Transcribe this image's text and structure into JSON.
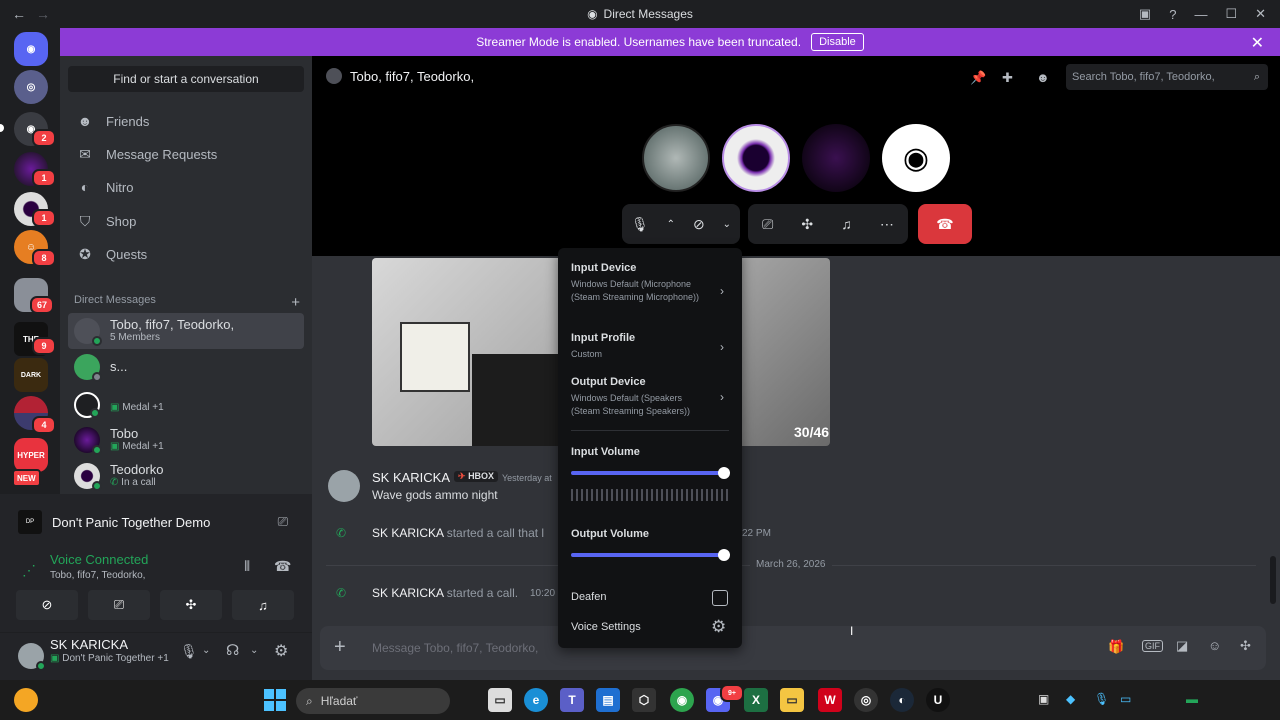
{
  "window": {
    "title": "Direct Messages"
  },
  "banner": {
    "text": "Streamer Mode is enabled. Usernames have been truncated.",
    "button": "Disable"
  },
  "dm_sidebar": {
    "search_label": "Find or start a conversation",
    "nav": [
      "Friends",
      "Message Requests",
      "Nitro",
      "Shop",
      "Quests"
    ],
    "dm_header": "Direct Messages",
    "items": [
      {
        "name": "Tobo, fifo7, Teodorko,",
        "sub": "5 Members"
      },
      {
        "name": "s...",
        "sub": ""
      },
      {
        "name": "",
        "sub": "Medal +1"
      },
      {
        "name": "Tobo",
        "sub": "Medal +1"
      },
      {
        "name": "Teodorko",
        "sub": "In a call"
      }
    ]
  },
  "guild_badges": [
    "2",
    "1",
    "1",
    "8",
    "67",
    "9",
    "4",
    "NEW"
  ],
  "activity": {
    "game": "Don't Panic Together Demo"
  },
  "voice": {
    "status": "Voice Connected",
    "channel": "Tobo, fifo7, Teodorko,"
  },
  "user": {
    "name": "SK KARICKA",
    "status": "Don't Panic Together +1"
  },
  "channel_header": {
    "title": "Tobo, fifo7, Teodorko,",
    "search_placeholder": "Search Tobo, fifo7, Teodorko,"
  },
  "popup": {
    "input_device_label": "Input Device",
    "input_device_value": "Windows Default (Microphone (Steam Streaming Microphone))",
    "input_profile_label": "Input Profile",
    "input_profile_value": "Custom",
    "output_device_label": "Output Device",
    "output_device_value": "Windows Default (Speakers (Steam Streaming Speakers))",
    "input_volume_label": "Input Volume",
    "input_volume": 100,
    "output_volume_label": "Output Volume",
    "output_volume": 100,
    "deafen_label": "Deafen",
    "voice_settings_label": "Voice Settings"
  },
  "messages": {
    "image_counter": "30/46",
    "author": "SK KARICKA",
    "tag": "HBOX",
    "time1": "Yesterday at",
    "text1": "Wave gods ammo night",
    "call1_author": "SK KARICKA",
    "call1_text": "started a call that l",
    "call1_time": "22 PM",
    "date_divider": "March 26, 2026",
    "call2_author": "SK KARICKA",
    "call2_text": "started a call.",
    "call2_time": "10:20"
  },
  "composer": {
    "placeholder": "Message Tobo, fifo7, Teodorko,"
  },
  "taskbar": {
    "search_placeholder": "Hľadať",
    "discord_badge": "9+"
  }
}
